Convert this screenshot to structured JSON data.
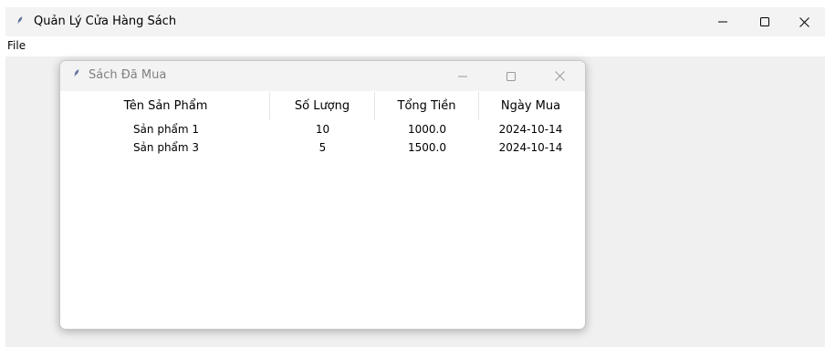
{
  "main_window": {
    "title": "Quản Lý Cửa Hàng Sách",
    "menu": {
      "file_label": "File"
    }
  },
  "sub_window": {
    "title": "Sách Đã Mua",
    "table": {
      "columns": [
        "Tên Sản Phẩm",
        "Số Lượng",
        "Tổng Tiền",
        "Ngày Mua"
      ],
      "rows": [
        [
          "Sản phẩm 1",
          "10",
          "1000.0",
          "2024-10-14"
        ],
        [
          "Sản phẩm 3",
          "5",
          "1500.0",
          "2024-10-14"
        ]
      ]
    }
  },
  "icons": {
    "app": "feather-icon",
    "minimize": "minimize-icon",
    "maximize": "maximize-icon",
    "close": "close-icon"
  },
  "colors": {
    "titlebar_bg": "#f3f3f3",
    "client_bg": "#f0f0f0",
    "table_bg": "#ffffff",
    "inactive_title_text": "#808080",
    "feather": "#4a5d8c"
  }
}
